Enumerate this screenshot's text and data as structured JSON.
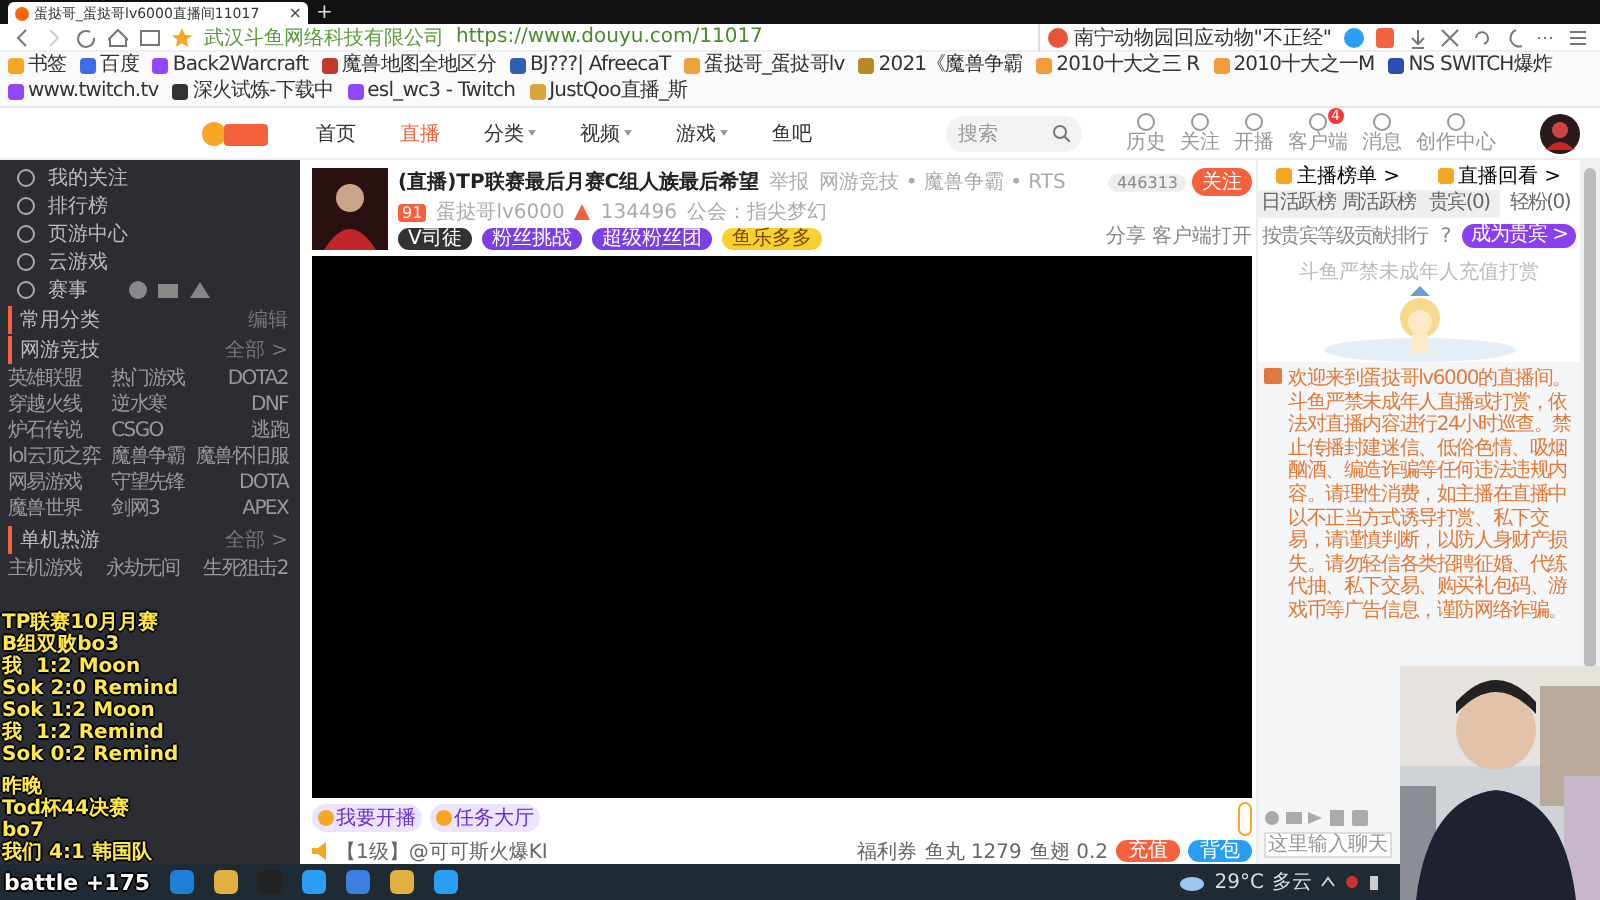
{
  "browser": {
    "tab_title": "蛋挞哥_蛋挞哥lv6000直播间11017",
    "tab_close": "×",
    "new_tab": "+",
    "site_owner": "武汉斗鱼网络科技有限公司",
    "url": "https://www.douyu.com/11017",
    "search_value": "南宁动物园回应动物\"不正经\"",
    "bookmarks": [
      "书签",
      "百度",
      "Back2Warcraft",
      "魔兽地图全地区分",
      "BJ???| AfreecaT",
      "蛋挞哥_蛋挞哥lv",
      "2021《魔兽争霸",
      "2010十大之三 R",
      "2010十大之一M",
      "NS SWITCH爆炸",
      "www.twitch.tv",
      "深火试炼-下载中",
      "esl_wc3 - Twitch",
      "JustQoo直播_斯"
    ]
  },
  "site_header": {
    "nav": [
      {
        "label": "首页",
        "selected": false,
        "dropdown": false
      },
      {
        "label": "直播",
        "selected": true,
        "dropdown": false
      },
      {
        "label": "分类",
        "selected": false,
        "dropdown": true
      },
      {
        "label": "视频",
        "selected": false,
        "dropdown": true
      },
      {
        "label": "游戏",
        "selected": false,
        "dropdown": true
      },
      {
        "label": "鱼吧",
        "selected": false,
        "dropdown": false
      }
    ],
    "search": {
      "placeholder": "搜索"
    },
    "actions": [
      {
        "label": "历史"
      },
      {
        "label": "关注"
      },
      {
        "label": "开播"
      },
      {
        "label": "客户端",
        "badge": "4"
      },
      {
        "label": "消息"
      },
      {
        "label": "创作中心"
      }
    ]
  },
  "sidebar": {
    "items": [
      "我的关注",
      "排行榜",
      "页游中心",
      "云游戏",
      "赛事"
    ],
    "sections": [
      {
        "title": "常用分类",
        "action": "编辑"
      },
      {
        "title": "网游竞技",
        "action": "全部 >",
        "categories": [
          "英雄联盟",
          "热门游戏",
          "DOTA2",
          "穿越火线",
          "逆水寒",
          "DNF",
          "炉石传说",
          "CSGO",
          "逃跑",
          "lol云顶之弈",
          "魔兽争霸",
          "魔兽怀旧服",
          "网易游戏",
          "守望先锋",
          "DOTA",
          "魔兽世界",
          "剑网3",
          "APEX"
        ]
      },
      {
        "title": "单机热游",
        "action": "全部 >",
        "categories": [
          "主机游戏",
          "永劫无间",
          "生死狙击2"
        ]
      }
    ]
  },
  "stream_overlay": {
    "lines": [
      "TP联赛10月月赛",
      "B组双败bo3",
      "我  1:2 Moon",
      "Sok 2:0 Remind",
      "Sok 1:2 Moon",
      "我  1:2 Remind",
      "Sok 0:2 Remind",
      "昨晚",
      "Tod杯44决赛",
      "bo7",
      "我们 4:1 韩国队"
    ],
    "footer": "battle +175"
  },
  "room": {
    "title": "(直播)TP联赛最后月赛C组人族最后希望",
    "report": "举报",
    "category": "网游竞技 • 魔兽争霸 • RTS",
    "level": "91",
    "streamer": "蛋挞哥lv6000",
    "heat": "134496",
    "guild": "公会：指尖梦幻",
    "pills": [
      "V司徒",
      "粉丝挑战",
      "超级粉丝团",
      "鱼乐多多"
    ],
    "followers": "446313",
    "follow": "关注",
    "share": "分享",
    "open_client": "客户端打开"
  },
  "gift_bar": {
    "gifts": [
      "我要开播",
      "任务大厅"
    ],
    "chat_line": "【1级】@可可斯火爆KI",
    "coupon": "福利券",
    "fish_ball": "鱼丸 1279",
    "fish_fin": "鱼翅 0.2",
    "recharge": "充值",
    "backpack": "背包"
  },
  "chat_panel": {
    "links": [
      "主播榜单 >",
      "直播回看 >"
    ],
    "tabs": [
      {
        "label": "日活跃榜",
        "selected": false
      },
      {
        "label": "周活跃榜",
        "selected": false
      },
      {
        "label": "贵宾(0)",
        "selected": false
      },
      {
        "label": "轻粉(0)",
        "selected": true
      }
    ],
    "rank_hint": "按贵宾等级贡献排行",
    "help": "?",
    "vip_button": "成为贵宾 >",
    "minor_notice": "斗鱼严禁未成年人充值打赏",
    "notice": "欢迎来到蛋挞哥lv6000的直播间。斗鱼严禁未成年人直播或打赏，依法对直播内容进行24小时巡查。禁止传播封建迷信、低俗色情、吸烟酗酒、编造诈骗等任何违法违规内容。请理性消费，如主播在直播中以不正当方式诱导打赏、私下交易，请谨慎判断，以防人身财产损失。请勿轻信各类招聘征婚、代练代抽、私下交易、购买礼包码、游戏币等广告信息，谨防网络诈骗。",
    "input": {
      "placeholder": "这里输入聊天"
    }
  },
  "taskbar": {
    "weather": "29°C",
    "condition": "多云"
  }
}
